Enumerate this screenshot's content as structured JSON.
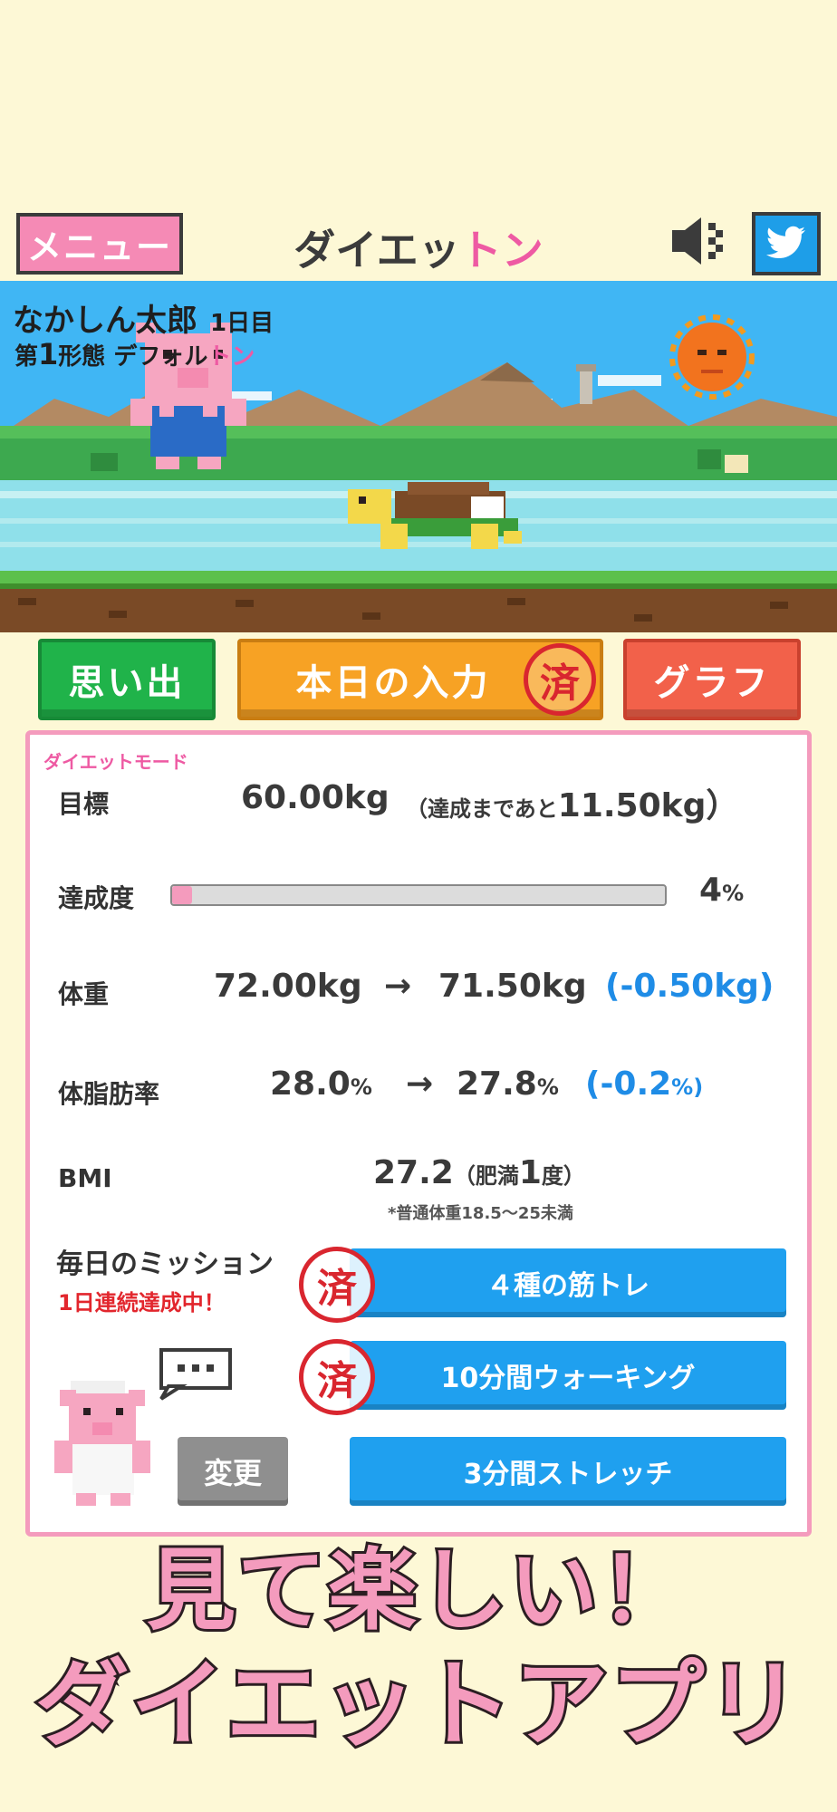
{
  "header": {
    "menu_label": "メニュー",
    "title_main": "ダイエッ",
    "title_accent": "トン"
  },
  "scene": {
    "player_name": "なかしん太郎",
    "day": "1日目",
    "form_prefix": "第",
    "form_number": "1",
    "form_mid": "形態 デフォル",
    "form_accent": "トン"
  },
  "actions": {
    "memory_label": "思い出",
    "today_label": "本日の入力",
    "stamp_label": "済",
    "graph_label": "グラフ"
  },
  "panel": {
    "mode_label": "ダイエットモード",
    "goal": {
      "label": "目標",
      "value": "60.00kg",
      "remaining": "（達成まであと",
      "remaining_value": "11.50kg）"
    },
    "progress": {
      "label": "達成度",
      "percent_value": "4",
      "percent_unit": "%",
      "fraction": 0.04
    },
    "weight": {
      "label": "体重",
      "from": "72.00kg",
      "arrow": "→",
      "to": "71.50kg",
      "diff": "(-0.50kg)"
    },
    "body_fat": {
      "label": "体脂肪率",
      "from_value": "28.0",
      "from_unit": "%",
      "arrow": "→",
      "to_value": "27.8",
      "to_unit": "%",
      "diff_value": "(-0.2",
      "diff_unit": "%)"
    },
    "bmi": {
      "label": "BMI",
      "value": "27.2",
      "class_text": "（肥満",
      "class_number": "1",
      "class_suffix": "度）",
      "note": "*普通体重18.5〜25未満"
    },
    "mission": {
      "title": "毎日のミッション",
      "streak": "1日連続達成中！",
      "items": [
        "４種の筋トレ",
        "10分間ウォーキング",
        "3分間ストレッチ"
      ],
      "stamp_label": "済",
      "change_label": "変更",
      "bubble_text": "…"
    }
  },
  "promo": {
    "line1": "見て楽しい！",
    "line2": "ダイエットアプリ"
  },
  "colors": {
    "background": "#fdf8d6",
    "pink": "#f49bbd",
    "accent_pink": "#ee5aa3",
    "blue": "#1fa0ef",
    "green": "#20b34a",
    "orange": "#f7a224",
    "red": "#f2614a",
    "stamp_red": "#d9262f"
  },
  "icons": [
    "speaker-mute-icon",
    "twitter-bird-icon",
    "speech-bubble-icon"
  ]
}
